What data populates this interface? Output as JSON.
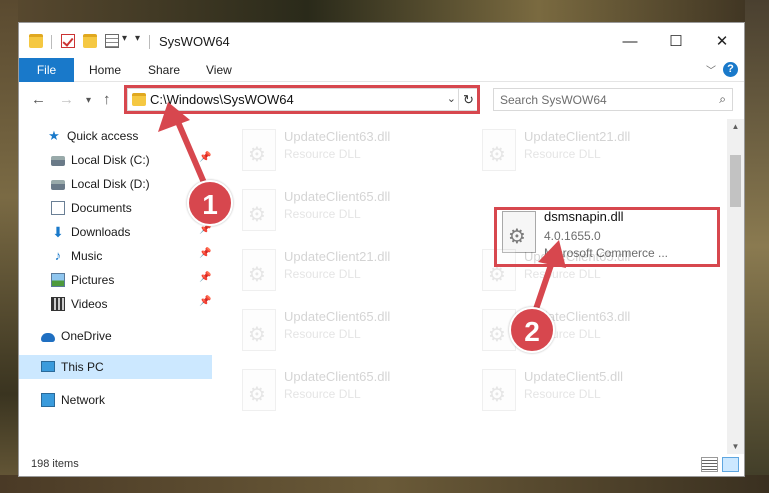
{
  "window": {
    "title": "SysWOW64",
    "minimize": "—",
    "maximize": "☐",
    "close": "✕"
  },
  "ribbon": {
    "tabs": [
      "File",
      "Home",
      "Share",
      "View"
    ],
    "help": "?"
  },
  "address": {
    "path": "C:\\Windows\\SysWOW64",
    "search_placeholder": "Search SysWOW64"
  },
  "nav_pane": {
    "items": [
      {
        "label": "Quick access",
        "icon": "star-icon"
      },
      {
        "label": "Local Disk (C:)",
        "icon": "drive-icon",
        "pinned": true
      },
      {
        "label": "Local Disk (D:)",
        "icon": "drive-icon"
      },
      {
        "label": "Documents",
        "icon": "documents-icon"
      },
      {
        "label": "Downloads",
        "icon": "download-icon",
        "pinned": true
      },
      {
        "label": "Music",
        "icon": "music-icon",
        "pinned": true
      },
      {
        "label": "Pictures",
        "icon": "pictures-icon",
        "pinned": true
      },
      {
        "label": "Videos",
        "icon": "videos-icon",
        "pinned": true
      },
      {
        "label": "OneDrive",
        "icon": "onedrive-icon"
      },
      {
        "label": "This PC",
        "icon": "this-pc-icon",
        "selected": true
      },
      {
        "label": "Network",
        "icon": "network-icon"
      }
    ]
  },
  "files": [
    {
      "name": "UpdateClient63.dll",
      "type": "Resource DLL"
    },
    {
      "name": "UpdateClient21.dll",
      "type": "Resource DLL"
    },
    {
      "name": "UpdateClient65.dll",
      "type": "Resource DLL"
    },
    {
      "name": "dsmsnapin.dll",
      "version": "4.0.1655.0",
      "company": "Microsoft Commerce ...",
      "highlighted": true
    },
    {
      "name": "UpdateClient21.dll",
      "type": "Resource DLL"
    },
    {
      "name": "UpdateClient65.dll",
      "type": "Resource DLL"
    },
    {
      "name": "UpdateClient65.dll",
      "type": "Resource DLL"
    },
    {
      "name": "UpdateClient63.dll",
      "type": "Resource DLL"
    },
    {
      "name": "UpdateClient65.dll",
      "type": "Resource DLL"
    },
    {
      "name": "UpdateClient5.dll",
      "type": "Resource DLL"
    }
  ],
  "status": {
    "item_count": "198 items"
  },
  "annotations": {
    "step1": "1",
    "step2": "2",
    "color": "#d7474e"
  }
}
